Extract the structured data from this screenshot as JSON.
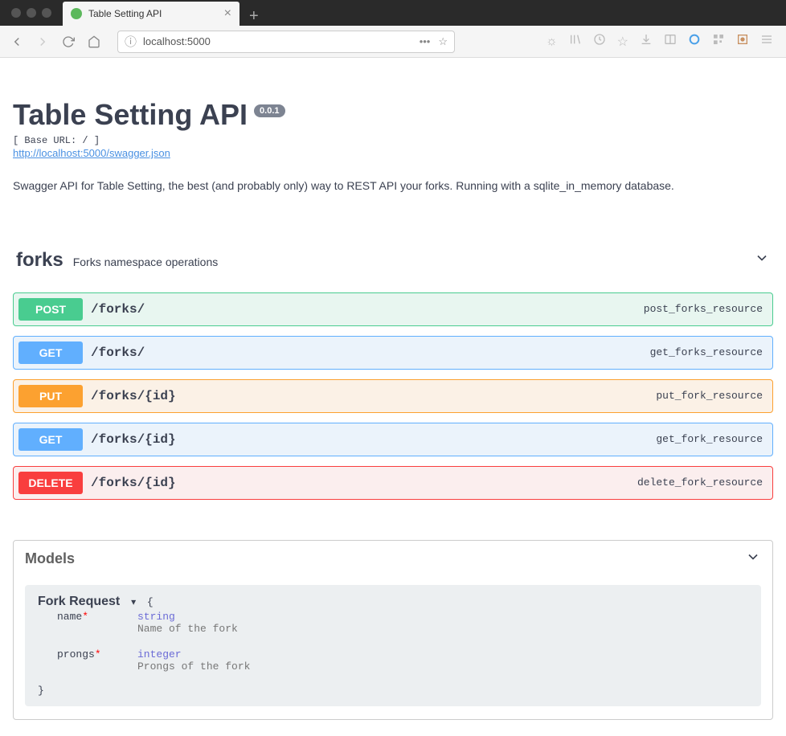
{
  "browser": {
    "tab_title": "Table Setting API",
    "url": "localhost:5000"
  },
  "header": {
    "title": "Table Setting API",
    "version": "0.0.1",
    "base_url_label": "[ Base URL: / ]",
    "swagger_url": "http://localhost:5000/swagger.json",
    "description": "Swagger API for Table Setting, the best (and probably only) way to REST API your forks. Running with a sqlite_in_memory database."
  },
  "section": {
    "name": "forks",
    "description": "Forks namespace operations",
    "operations": [
      {
        "method": "POST",
        "path": "/forks/",
        "op_id": "post_forks_resource",
        "css": "post"
      },
      {
        "method": "GET",
        "path": "/forks/",
        "op_id": "get_forks_resource",
        "css": "get"
      },
      {
        "method": "PUT",
        "path": "/forks/{id}",
        "op_id": "put_fork_resource",
        "css": "put"
      },
      {
        "method": "GET",
        "path": "/forks/{id}",
        "op_id": "get_fork_resource",
        "css": "get"
      },
      {
        "method": "DELETE",
        "path": "/forks/{id}",
        "op_id": "delete_fork_resource",
        "css": "delete"
      }
    ]
  },
  "models": {
    "title": "Models",
    "model_name": "Fork Request",
    "brace_open": "{",
    "brace_close": "}",
    "props": [
      {
        "name": "name",
        "required": "*",
        "type": "string",
        "desc": "Name of the fork"
      },
      {
        "name": "prongs",
        "required": "*",
        "type": "integer",
        "desc": "Prongs of the fork"
      }
    ]
  }
}
